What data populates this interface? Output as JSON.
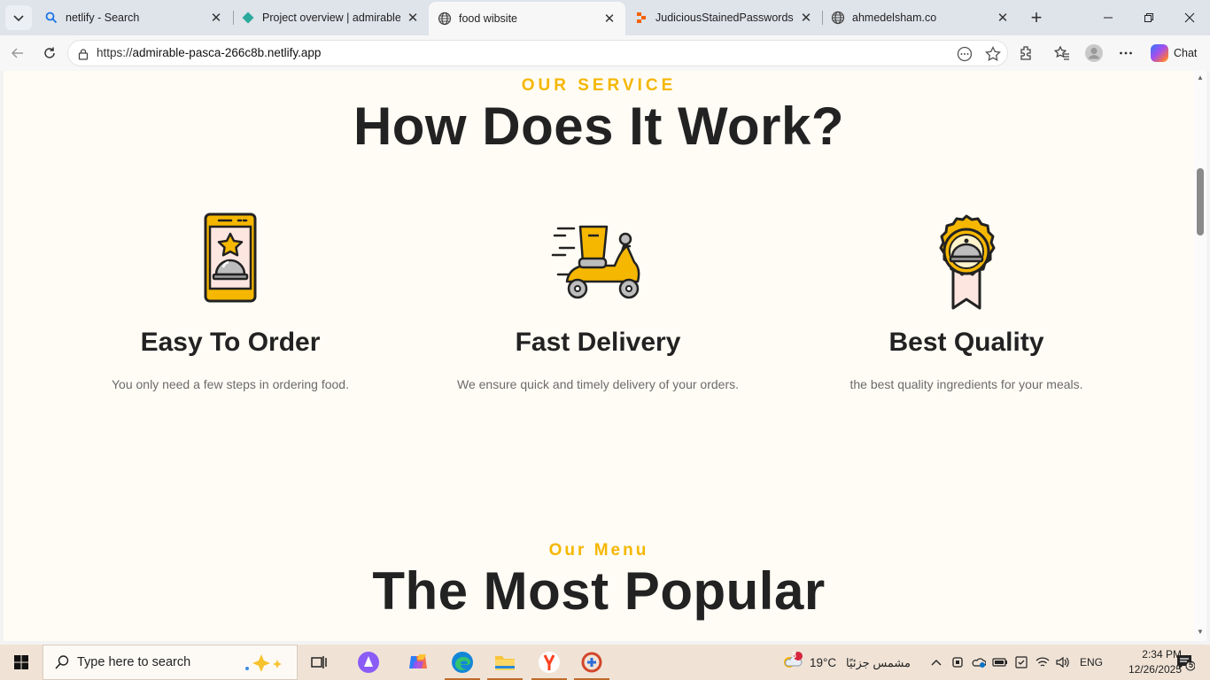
{
  "browser": {
    "tabs": [
      {
        "title": "netlify - Search",
        "icon": "search-icon"
      },
      {
        "title": "Project overview | admirable-pa",
        "icon": "netlify-icon"
      },
      {
        "title": "food wibsite",
        "icon": "globe-icon",
        "active": true
      },
      {
        "title": "JudiciousStainedPasswords - Re",
        "icon": "replit-icon"
      },
      {
        "title": "ahmedelsham.co",
        "icon": "globe-icon"
      }
    ],
    "url": {
      "scheme": "https://",
      "host": "admirable-pasca-266c8b.netlify.app"
    },
    "chat_label": "Chat",
    "accent": "#c06a2b"
  },
  "page": {
    "service": {
      "eyebrow": "OUR SERVICE",
      "heading": "How Does It Work?",
      "steps": [
        {
          "title": "Easy To Order",
          "text": "You only need a few steps in ordering food.",
          "icon": "phone-cloche-icon"
        },
        {
          "title": "Fast Delivery",
          "text": "We ensure quick and timely delivery of your orders.",
          "icon": "scooter-icon"
        },
        {
          "title": "Best Quality",
          "text": "the best quality ingredients for your meals.",
          "icon": "badge-cloche-icon"
        }
      ]
    },
    "menu": {
      "eyebrow": "Our Menu",
      "heading": "The Most Popular"
    },
    "accent_color": "#f5b700"
  },
  "taskbar": {
    "search_placeholder": "Type here to search",
    "weather": {
      "temp": "19°C",
      "desc": "مشمس جزئيًا",
      "badge": "3"
    },
    "language": "ENG",
    "time": "2:34 PM",
    "date": "12/26/2025",
    "notifications": "5"
  }
}
